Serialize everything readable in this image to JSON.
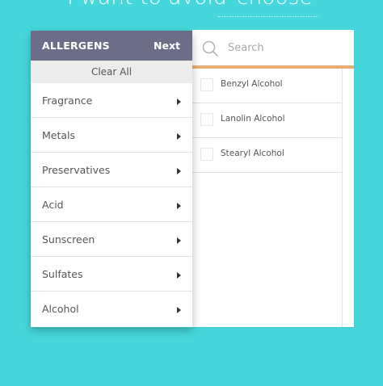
{
  "heading": {
    "prefix": "I want to avoid",
    "choose": "choose"
  },
  "menu": {
    "title": "ALLERGENS",
    "next_label": "Next",
    "clear_all_label": "Clear All",
    "categories": [
      {
        "label": "Fragrance"
      },
      {
        "label": "Metals"
      },
      {
        "label": "Preservatives"
      },
      {
        "label": "Acid"
      },
      {
        "label": "Sunscreen"
      },
      {
        "label": "Sulfates"
      },
      {
        "label": "Alcohol"
      }
    ]
  },
  "search": {
    "placeholder": "Search",
    "value": ""
  },
  "options": [
    {
      "label": "Benzyl Alcohol",
      "checked": false
    },
    {
      "label": "Lanolin Alcohol",
      "checked": false
    },
    {
      "label": "Stearyl Alcohol",
      "checked": false
    }
  ],
  "colors": {
    "background": "#45d7db",
    "menu_header": "#6b6e86",
    "search_accent": "#e8ad72"
  },
  "icons": {
    "search": "search-icon",
    "caret": "caret-right-icon"
  }
}
